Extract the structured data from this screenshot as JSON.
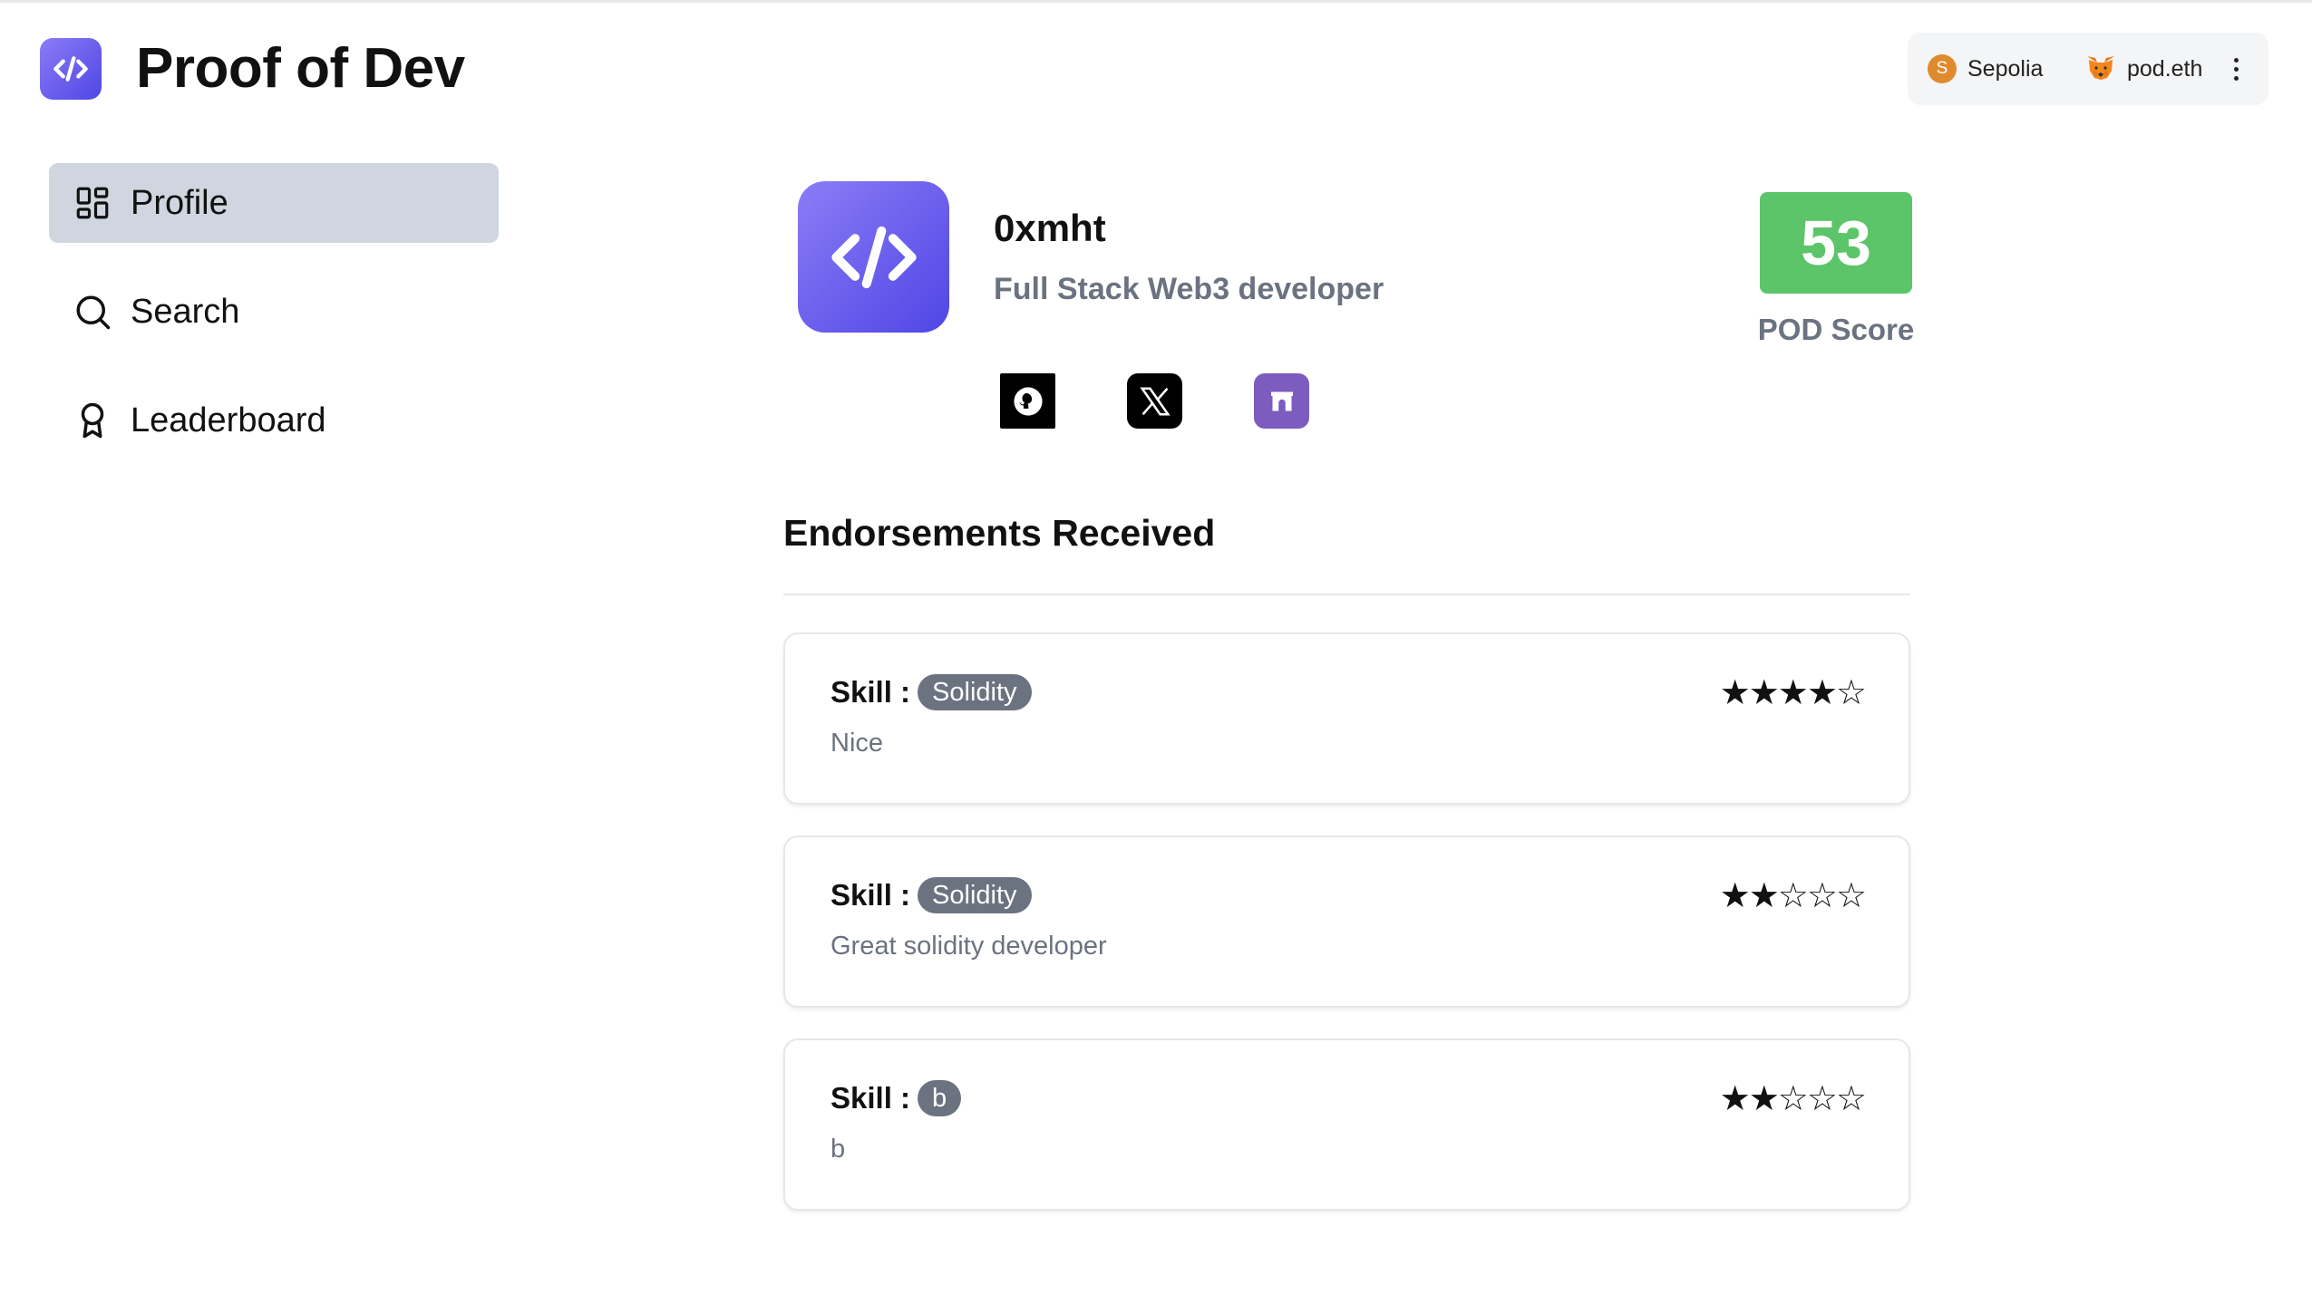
{
  "app": {
    "title": "Proof of Dev",
    "brand_gradient": [
      "#8b7cf6",
      "#4f46e5"
    ]
  },
  "wallet": {
    "network_label": "Sepolia",
    "network_initial": "S",
    "network_color": "#e08a2e",
    "account_label": "pod.eth",
    "account_icon": "metamask-fox-icon",
    "menu_icon": "kebab-menu-icon"
  },
  "sidebar": {
    "items": [
      {
        "label": "Profile",
        "icon": "grid-icon",
        "active": true
      },
      {
        "label": "Search",
        "icon": "search-icon",
        "active": false
      },
      {
        "label": "Leaderboard",
        "icon": "award-icon",
        "active": false
      }
    ]
  },
  "profile": {
    "handle": "0xmht",
    "bio": "Full Stack Web3 developer",
    "avatar_icon": "code-icon",
    "socials": [
      {
        "name": "github",
        "icon": "github-icon"
      },
      {
        "name": "x",
        "icon": "x-icon"
      },
      {
        "name": "farcaster",
        "icon": "farcaster-icon"
      }
    ],
    "score": {
      "value": "53",
      "label": "POD Score",
      "color": "#5cc56a"
    }
  },
  "endorsements": {
    "title": "Endorsements Received",
    "skill_prefix": "Skill :",
    "items": [
      {
        "skill": "Solidity",
        "comment": "Nice",
        "rating": 4,
        "max": 5,
        "stars": "★★★★☆"
      },
      {
        "skill": "Solidity",
        "comment": "Great solidity developer",
        "rating": 2,
        "max": 5,
        "stars": "★★☆☆☆"
      },
      {
        "skill": "b",
        "comment": "b",
        "rating": 2,
        "max": 5,
        "stars": "★★☆☆☆"
      }
    ]
  }
}
